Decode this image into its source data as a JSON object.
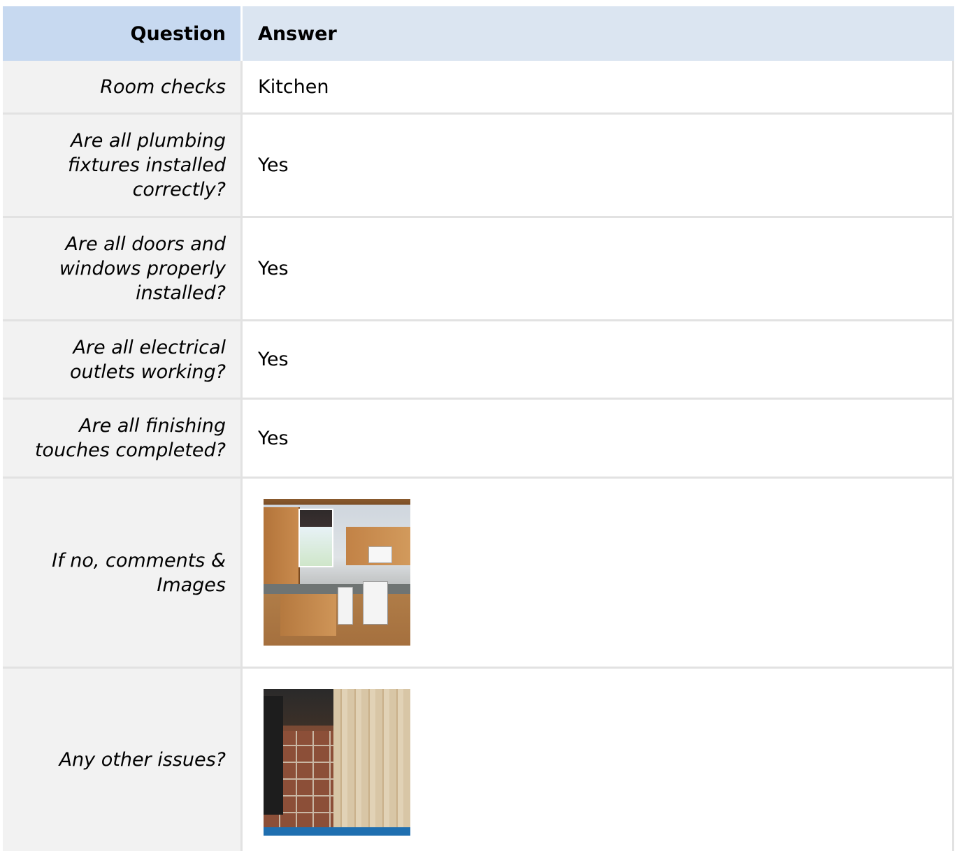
{
  "header": {
    "question": "Question",
    "answer": "Answer"
  },
  "rows": [
    {
      "question": "Room checks",
      "answer": "Kitchen"
    },
    {
      "question": "Are all plumbing fixtures installed correctly?",
      "answer": "Yes"
    },
    {
      "question": "Are all doors and windows properly installed?",
      "answer": "Yes"
    },
    {
      "question": "Are all electrical outlets working?",
      "answer": "Yes"
    },
    {
      "question": "Are all finishing touches completed?",
      "answer": "Yes"
    },
    {
      "question": "If no, comments & Images"
    },
    {
      "question": "Any other issues?"
    }
  ]
}
